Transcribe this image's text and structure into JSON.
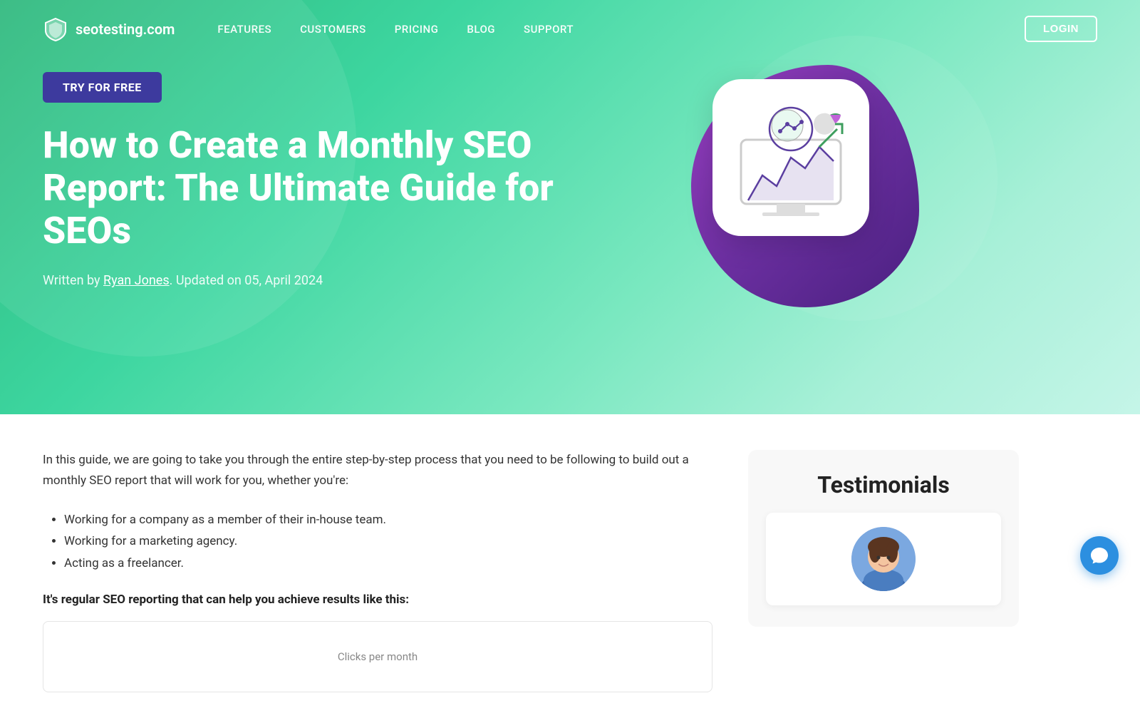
{
  "brand": {
    "name": "seotesting.com",
    "logo_alt": "seotesting logo"
  },
  "nav": {
    "links": [
      {
        "id": "features",
        "label": "FEATURES"
      },
      {
        "id": "customers",
        "label": "CUSTOMERS"
      },
      {
        "id": "pricing",
        "label": "PRICING"
      },
      {
        "id": "blog",
        "label": "BLOG"
      },
      {
        "id": "support",
        "label": "SUPPORT"
      }
    ],
    "login_label": "LOGIN",
    "try_label": "TRY FOR FREE"
  },
  "hero": {
    "title": "How to Create a Monthly SEO Report: The Ultimate Guide for SEOs",
    "author": "Ryan Jones",
    "updated_label": "Written by",
    "updated_text": ". Updated on 05, April 2024",
    "try_label": "TRY FOR FREE"
  },
  "article": {
    "intro": "In this guide, we are going to take you through the entire step-by-step process that you need to be following to build out a monthly SEO report that will work for you, whether you're:",
    "bullets": [
      "Working for a company as a member of their in-house team.",
      "Working for a marketing agency.",
      "Acting as a freelancer."
    ],
    "bold_text": "It's regular SEO reporting that can help you achieve results like this:",
    "chart_label": "Clicks per month"
  },
  "sidebar": {
    "testimonials_title": "Testimonials"
  },
  "colors": {
    "header_gradient_start": "#2db87c",
    "header_gradient_end": "#a8f0d8",
    "try_btn_bg": "#3d3a9e",
    "nav_link_color": "#ffffff",
    "chat_btn": "#2c8fe0"
  }
}
